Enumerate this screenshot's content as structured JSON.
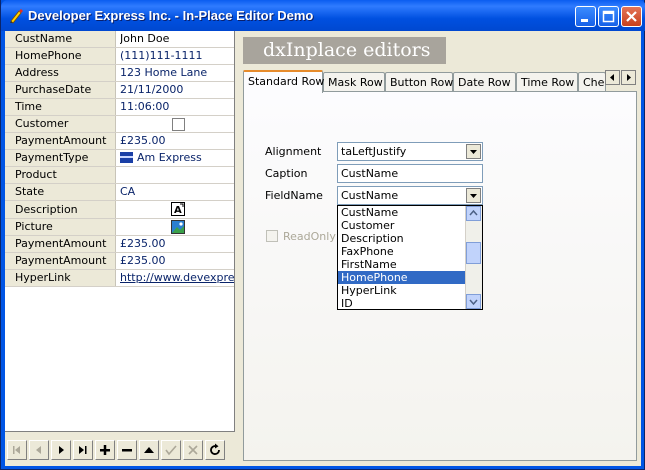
{
  "window": {
    "title": "Developer Express Inc. - In-Place Editor Demo"
  },
  "grid": {
    "rows": [
      {
        "caption": "CustName",
        "value": "John Doe"
      },
      {
        "caption": "HomePhone",
        "value": "(111)111-1111"
      },
      {
        "caption": "Address",
        "value": "123 Home Lane"
      },
      {
        "caption": "PurchaseDate",
        "value": "21/11/2000"
      },
      {
        "caption": "Time",
        "value": "11:06:00"
      },
      {
        "caption": "Customer",
        "value": ""
      },
      {
        "caption": "PaymentAmount",
        "value": "£235.00"
      },
      {
        "caption": "PaymentType",
        "value": "Am Express"
      },
      {
        "caption": "Product",
        "value": ""
      },
      {
        "caption": "State",
        "value": "CA"
      },
      {
        "caption": "Description",
        "value": ""
      },
      {
        "caption": "Picture",
        "value": ""
      },
      {
        "caption": "PaymentAmount",
        "value": "£235.00"
      },
      {
        "caption": "PaymentAmount",
        "value": "£235.00"
      },
      {
        "caption": "HyperLink",
        "value": "http://www.devexpre..."
      }
    ]
  },
  "banner": {
    "text": "dxInplace editors"
  },
  "tabs": [
    "Standard Row",
    "Mask Row",
    "Button Row",
    "Date Row",
    "Time Row",
    "Chec"
  ],
  "form": {
    "alignment_label": "Alignment",
    "alignment_value": "taLeftJustify",
    "caption_label": "Caption",
    "caption_value": "CustName",
    "fieldname_label": "FieldName",
    "fieldname_value": "CustName",
    "readonly_label": "ReadOnly",
    "dropdown_items": [
      "CustName",
      "Customer",
      "Description",
      "FaxPhone",
      "FirstName",
      "HomePhone",
      "HyperLink",
      "ID"
    ],
    "selected_item": "HomePhone"
  },
  "colors": {
    "accent": "#316ac5",
    "titlebar": "#0054e3"
  }
}
